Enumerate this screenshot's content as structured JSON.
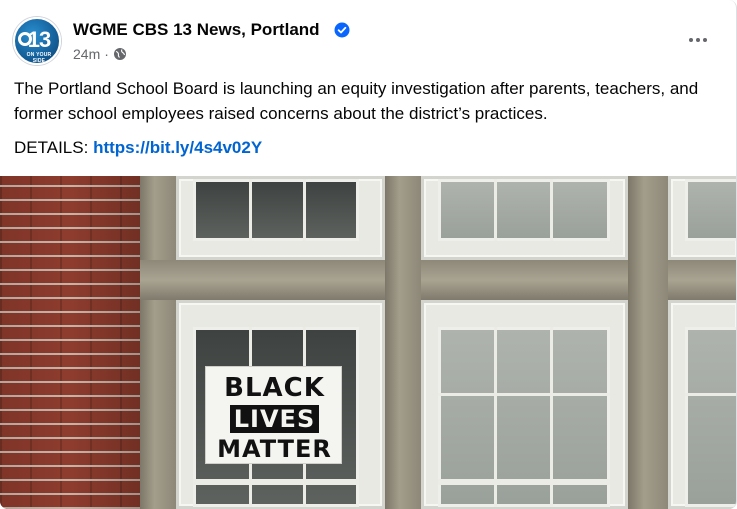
{
  "post": {
    "page_name": "WGME CBS 13 News, Portland",
    "verified_icon": "verified-badge-icon",
    "time_ago": "24m",
    "separator": "·",
    "privacy_icon": "globe-icon",
    "more_icon": "more-options-icon",
    "text": "The Portland School Board is launching an equity investigation after parents, teachers, and former school employees raised concerns about the district’s practices.",
    "details_label": "DETAILS:",
    "details_link": "https://bit.ly/4s4v02Y",
    "avatar": {
      "logo_number": "13",
      "logo_tagline": "ON YOUR SIDE"
    }
  },
  "photo": {
    "sign_lines": [
      "BLACK",
      "LIVES",
      "MATTER"
    ]
  },
  "colors": {
    "link": "#0064d1",
    "text": "#050505",
    "secondary": "#65676b",
    "verified": "#0866ff"
  }
}
